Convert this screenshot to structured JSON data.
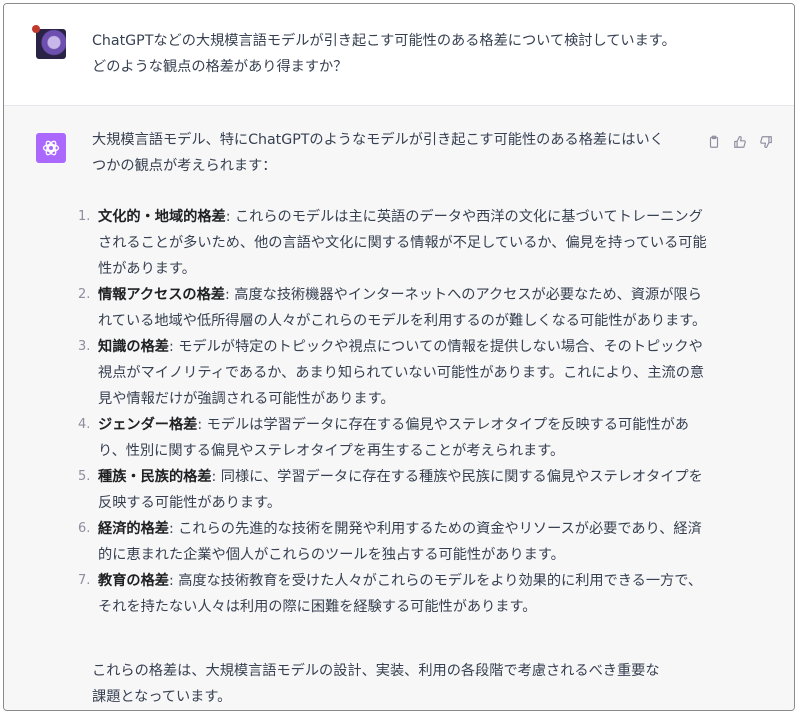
{
  "user_message": {
    "text": "ChatGPTなどの大規模言語モデルが引き起こす可能性のある格差について検討しています。\nどのような観点の格差があり得ますか？"
  },
  "assistant_message": {
    "intro": "大規模言語モデル、特にChatGPTのようなモデルが引き起こす可能性のある格差にはいく\nつかの観点が考えられます：",
    "items": [
      {
        "num": "1.",
        "title": "文化的・地域的格差",
        "body": ": これらのモデルは主に英語のデータや西洋の文化に基づいてトレーニングされることが多いため、他の言語や文化に関する情報が不足しているか、偏見を持っている可能性があります。"
      },
      {
        "num": "2.",
        "title": "情報アクセスの格差",
        "body": ": 高度な技術機器やインターネットへのアクセスが必要なため、資源が限られている地域や低所得層の人々がこれらのモデルを利用するのが難しくなる可能性があります。"
      },
      {
        "num": "3.",
        "title": "知識の格差",
        "body": ": モデルが特定のトピックや視点についての情報を提供しない場合、そのトピックや視点がマイノリティであるか、あまり知られていない可能性があります。これにより、主流の意見や情報だけが強調される可能性があります。"
      },
      {
        "num": "4.",
        "title": "ジェンダー格差",
        "body": ": モデルは学習データに存在する偏見やステレオタイプを反映する可能性があり、性別に関する偏見やステレオタイプを再生することが考えられます。"
      },
      {
        "num": "5.",
        "title": "種族・民族的格差",
        "body": ": 同様に、学習データに存在する種族や民族に関する偏見やステレオタイプを反映する可能性があります。"
      },
      {
        "num": "6.",
        "title": "経済的格差",
        "body": ": これらの先進的な技術を開発や利用するための資金やリソースが必要であり、経済的に恵まれた企業や個人がこれらのツールを独占する可能性があります。"
      },
      {
        "num": "7.",
        "title": "教育の格差",
        "body": ": 高度な技術教育を受けた人々がこれらのモデルをより効果的に利用できる一方で、それを持たない人々は利用の際に困難を経験する可能性があります。"
      }
    ],
    "outro": "これらの格差は、大規模言語モデルの設計、実装、利用の各段階で考慮されるべき重要な\n課題となっています。"
  },
  "icons": {
    "copy": "clipboard-icon",
    "like": "thumbs-up-icon",
    "dislike": "thumbs-down-icon",
    "bot": "openai-logo-icon"
  },
  "colors": {
    "bot_avatar": "#ab68ff",
    "assistant_bg": "#f7f7f8",
    "text": "#374151"
  }
}
